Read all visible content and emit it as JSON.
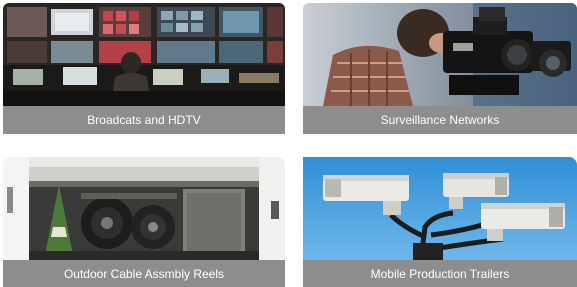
{
  "tiles": [
    {
      "caption": "Broadcats and HDTV",
      "image": "broadcast-control-room"
    },
    {
      "caption": "Surveillance Networks",
      "image": "camera-operator"
    },
    {
      "caption": "Outdoor Cable Assmbly Reels",
      "image": "cable-reels-in-van"
    },
    {
      "caption": "Mobile Production Trailers",
      "image": "security-cameras"
    }
  ]
}
